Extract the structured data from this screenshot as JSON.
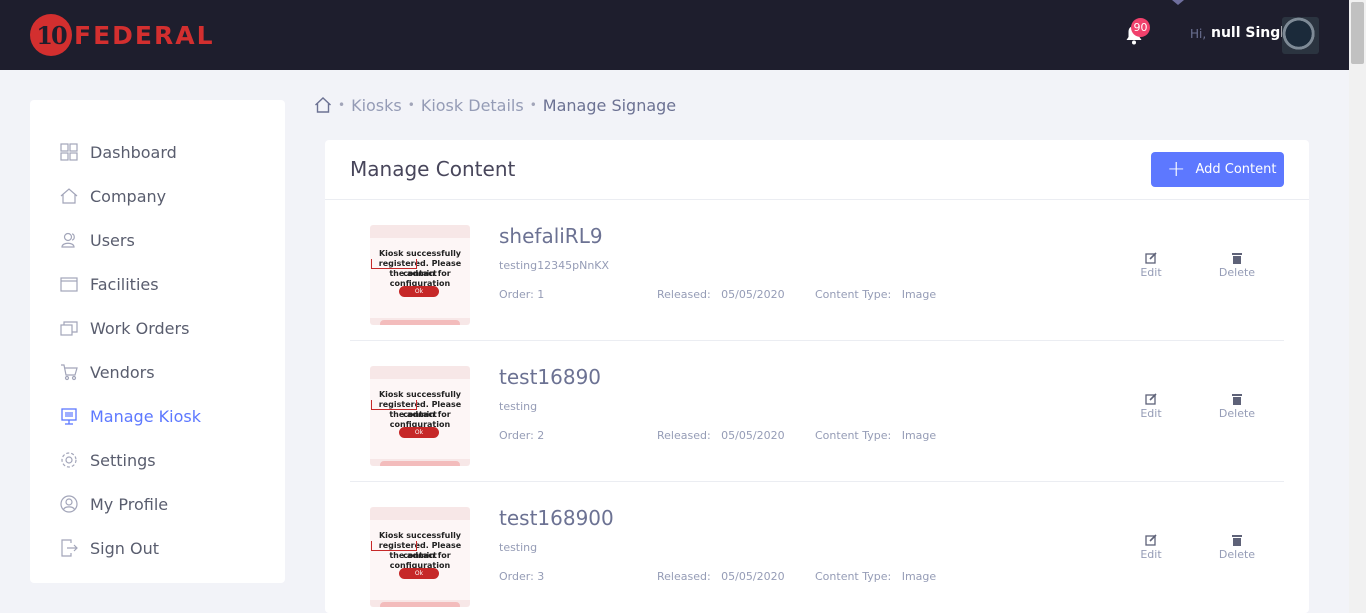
{
  "header": {
    "logo_number": "10",
    "logo_text": "FEDERAL",
    "notification_count": "90",
    "greeting": "Hi,",
    "user_name": "null Singh"
  },
  "sidebar": {
    "items": [
      {
        "label": "Dashboard",
        "icon": "dashboard-icon"
      },
      {
        "label": "Company",
        "icon": "home-icon"
      },
      {
        "label": "Users",
        "icon": "users-icon"
      },
      {
        "label": "Facilities",
        "icon": "facilities-icon"
      },
      {
        "label": "Work Orders",
        "icon": "work-orders-icon"
      },
      {
        "label": "Vendors",
        "icon": "cart-icon"
      },
      {
        "label": "Manage Kiosk",
        "icon": "kiosk-icon",
        "active": true
      },
      {
        "label": "Settings",
        "icon": "gear-icon"
      },
      {
        "label": "My Profile",
        "icon": "profile-icon"
      },
      {
        "label": "Sign Out",
        "icon": "sign-out-icon"
      }
    ]
  },
  "breadcrumb": {
    "items": [
      "Kiosks",
      "Kiosk Details"
    ],
    "current": "Manage Signage"
  },
  "main": {
    "title": "Manage Content",
    "add_button": "Add Content",
    "thumbnail_text": {
      "line1": "Kiosk successfully",
      "line2": "registered. Please contact",
      "line3": "the admin for configuration",
      "button": "Ok"
    },
    "labels": {
      "order": "Order:",
      "released": "Released:",
      "content_type": "Content Type:",
      "edit": "Edit",
      "delete": "Delete"
    },
    "items": [
      {
        "title": "shefaliRL9",
        "description": "testing12345pNnKX",
        "order": "1",
        "released": "05/05/2020",
        "content_type": "Image"
      },
      {
        "title": "test16890",
        "description": "testing",
        "order": "2",
        "released": "05/05/2020",
        "content_type": "Image"
      },
      {
        "title": "test168900",
        "description": "testing",
        "order": "3",
        "released": "05/05/2020",
        "content_type": "Image"
      }
    ]
  },
  "colors": {
    "header_bg": "#1e1e2d",
    "accent": "#5d78ff",
    "brand_red": "#d32f2f",
    "badge": "#f1416c"
  }
}
